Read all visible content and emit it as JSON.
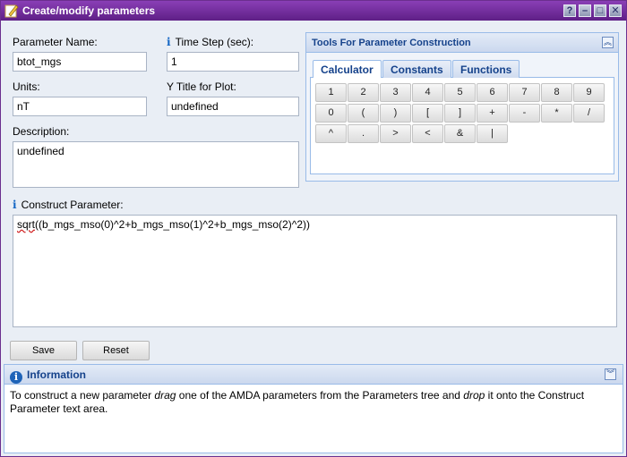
{
  "window": {
    "title": "Create/modify parameters",
    "buttons": {
      "help": "?",
      "minimize": "–",
      "maximize": "□",
      "close": "✕"
    }
  },
  "form": {
    "param_name": {
      "label": "Parameter Name:",
      "value": "btot_mgs"
    },
    "time_step": {
      "label": "Time Step (sec):",
      "value": "1"
    },
    "units": {
      "label": "Units:",
      "value": "nT"
    },
    "y_title": {
      "label": "Y Title for Plot:",
      "value": "undefined"
    },
    "description": {
      "label": "Description:",
      "value": "undefined"
    },
    "construct": {
      "label": "Construct Parameter:",
      "value_prefix": "sqrt",
      "value_rest": "((b_mgs_mso(0)^2+b_mgs_mso(1)^2+b_mgs_mso(2)^2))"
    }
  },
  "tools": {
    "title": "Tools For Parameter Construction",
    "tabs": [
      "Calculator",
      "Constants",
      "Functions"
    ],
    "active_tab": "Calculator",
    "keys_row1": [
      "1",
      "2",
      "3",
      "4",
      "5",
      "6",
      "7",
      "8",
      "9"
    ],
    "keys_row2": [
      "0",
      "(",
      ")",
      "[",
      "]",
      "+",
      "-",
      "*",
      "/"
    ],
    "keys_row3": [
      "^",
      ".",
      ">",
      "<",
      "&",
      "|"
    ]
  },
  "actions": {
    "save": "Save",
    "reset": "Reset"
  },
  "information": {
    "title": "Information",
    "t1": "To construct a new parameter ",
    "t2": "drag",
    "t3": " one of the AMDA parameters from the Parameters tree and ",
    "t4": "drop",
    "t5": " it onto the Construct Parameter text area."
  },
  "colors": {
    "title_bar": "#6b2f8f",
    "panel_header_text": "#15428b",
    "info_icon": "#1e63b8"
  }
}
